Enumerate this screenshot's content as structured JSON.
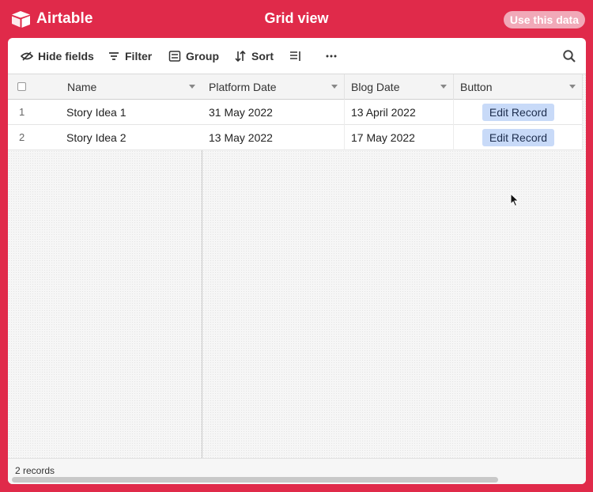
{
  "app": {
    "name": "Airtable",
    "view_title": "Grid view",
    "use_data_label": "Use this data"
  },
  "toolbar": {
    "hide_fields": "Hide fields",
    "filter": "Filter",
    "group": "Group",
    "sort": "Sort",
    "row_height_icon": "row-height-icon",
    "more_icon": "more-icon",
    "search_icon": "search-icon"
  },
  "grid": {
    "columns": [
      "Name",
      "Platform Date",
      "Blog Date",
      "Button"
    ],
    "rows": [
      {
        "num": "1",
        "name": "Story Idea 1",
        "platform_date": "31 May 2022",
        "blog_date": "13 April 2022",
        "button": "Edit Record"
      },
      {
        "num": "2",
        "name": "Story Idea 2",
        "platform_date": "13 May 2022",
        "blog_date": "17 May 2022",
        "button": "Edit Record"
      }
    ]
  },
  "footer": {
    "records": "2 records"
  },
  "colors": {
    "brand": "#e02a4a",
    "button_bg": "#c8daf8"
  }
}
